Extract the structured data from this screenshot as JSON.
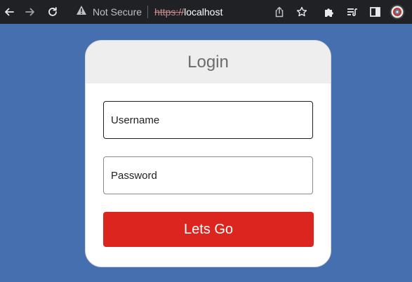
{
  "browser": {
    "security_label": "Not Secure",
    "url_scheme": "https://",
    "url_host": "localhost",
    "icons": {
      "back": "back-arrow-icon",
      "forward": "forward-arrow-icon",
      "reload": "reload-icon",
      "warning": "warning-icon",
      "share": "share-icon",
      "bookmark": "star-icon",
      "extensions": "puzzle-icon",
      "reading_list": "reading-list-icon",
      "side_panel": "side-panel-icon",
      "profile": "profile-avatar-icon"
    },
    "colors": {
      "toolbar_bg": "#202124",
      "page_bg": "#456fae"
    }
  },
  "login": {
    "title": "Login",
    "username_placeholder": "Username",
    "password_placeholder": "Password",
    "submit_label": "Lets Go",
    "colors": {
      "header_bg": "#eeeeee",
      "button_bg": "#dd2520",
      "button_text": "#ffffff"
    }
  }
}
